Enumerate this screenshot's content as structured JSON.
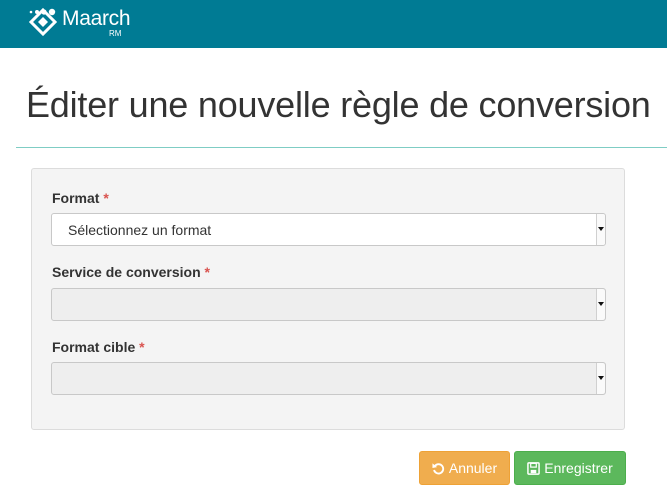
{
  "header": {
    "brand_name": "Maarch",
    "brand_sub": "RM",
    "background_color": "#007b94"
  },
  "page": {
    "title": "Éditer une nouvelle règle de conversion"
  },
  "form": {
    "required_marker": "*",
    "fields": [
      {
        "label": "Format",
        "value": "Sélectionnez un format",
        "disabled": false
      },
      {
        "label": "Service de conversion",
        "value": "",
        "disabled": true
      },
      {
        "label": "Format cible",
        "value": "",
        "disabled": true
      }
    ]
  },
  "actions": {
    "cancel_label": "Annuler",
    "cancel_icon": "undo-icon",
    "cancel_color": "#f0ad4e",
    "save_label": "Enregistrer",
    "save_icon": "floppy-disk-icon",
    "save_color": "#5cb85c"
  }
}
